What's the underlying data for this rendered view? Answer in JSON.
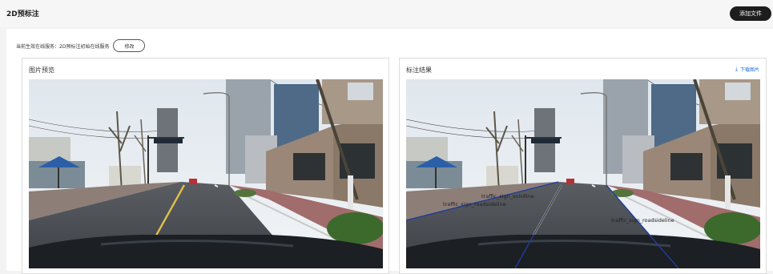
{
  "header": {
    "title": "2D预标注",
    "add_file_label": "添加文件"
  },
  "service": {
    "text": "当前生效在线服务：2D预标注初始在线服务",
    "modify_label": "修改"
  },
  "preview_panel": {
    "title": "图片预览"
  },
  "result_panel": {
    "title": "标注结果",
    "download_label": "下载图片",
    "annotations": [
      "traffic_sign_solidline",
      "traffic_sign_roadsideline",
      "traffic_sign_roadsideline"
    ]
  },
  "icons": {
    "download": "download-icon"
  }
}
